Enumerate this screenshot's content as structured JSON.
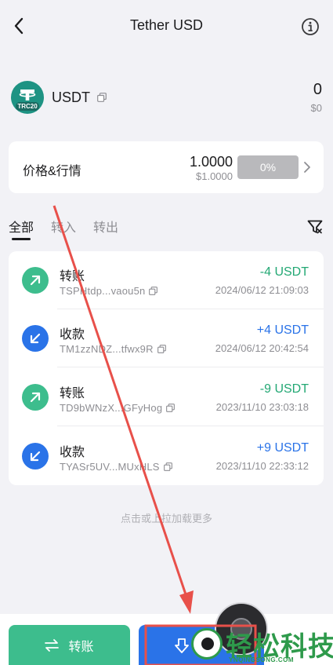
{
  "header": {
    "title": "Tether USD",
    "back_icon": "chevron-left-icon",
    "info_icon": "info-circle-icon"
  },
  "asset": {
    "symbol": "USDT",
    "network_badge": "TRC20",
    "balance": "0",
    "balance_fiat": "$0",
    "logo_color": "#1e9383"
  },
  "price": {
    "label": "价格&行情",
    "value": "1.0000",
    "fiat": "$1.0000",
    "change": "0%"
  },
  "tabs": [
    {
      "label": "全部",
      "active": true
    },
    {
      "label": "转入",
      "active": false
    },
    {
      "label": "转出",
      "active": false
    }
  ],
  "transactions": [
    {
      "type": "out",
      "title": "转账",
      "address": "TSPHtdp...vaou5n",
      "amount": "-4 USDT",
      "date": "2024/06/12 21:09:03"
    },
    {
      "type": "in",
      "title": "收款",
      "address": "TM1zzNDZ...tfwx9R",
      "amount": "+4 USDT",
      "date": "2024/06/12 20:42:54"
    },
    {
      "type": "out",
      "title": "转账",
      "address": "TD9bWNzX...GFyHog",
      "amount": "-9 USDT",
      "date": "2023/11/10 23:03:18"
    },
    {
      "type": "in",
      "title": "收款",
      "address": "TYASr5UV...MUxHLS",
      "amount": "+9 USDT",
      "date": "2023/11/10 22:33:12"
    }
  ],
  "load_more": "点击或上拉加载更多",
  "actions": {
    "transfer_label": "转账"
  },
  "watermark": {
    "text": "轻松科技",
    "sub": "YNQINGSONG.COM"
  },
  "colors": {
    "green": "#3dbd8d",
    "blue": "#2a73e8",
    "annotation_red": "#e8504a"
  }
}
